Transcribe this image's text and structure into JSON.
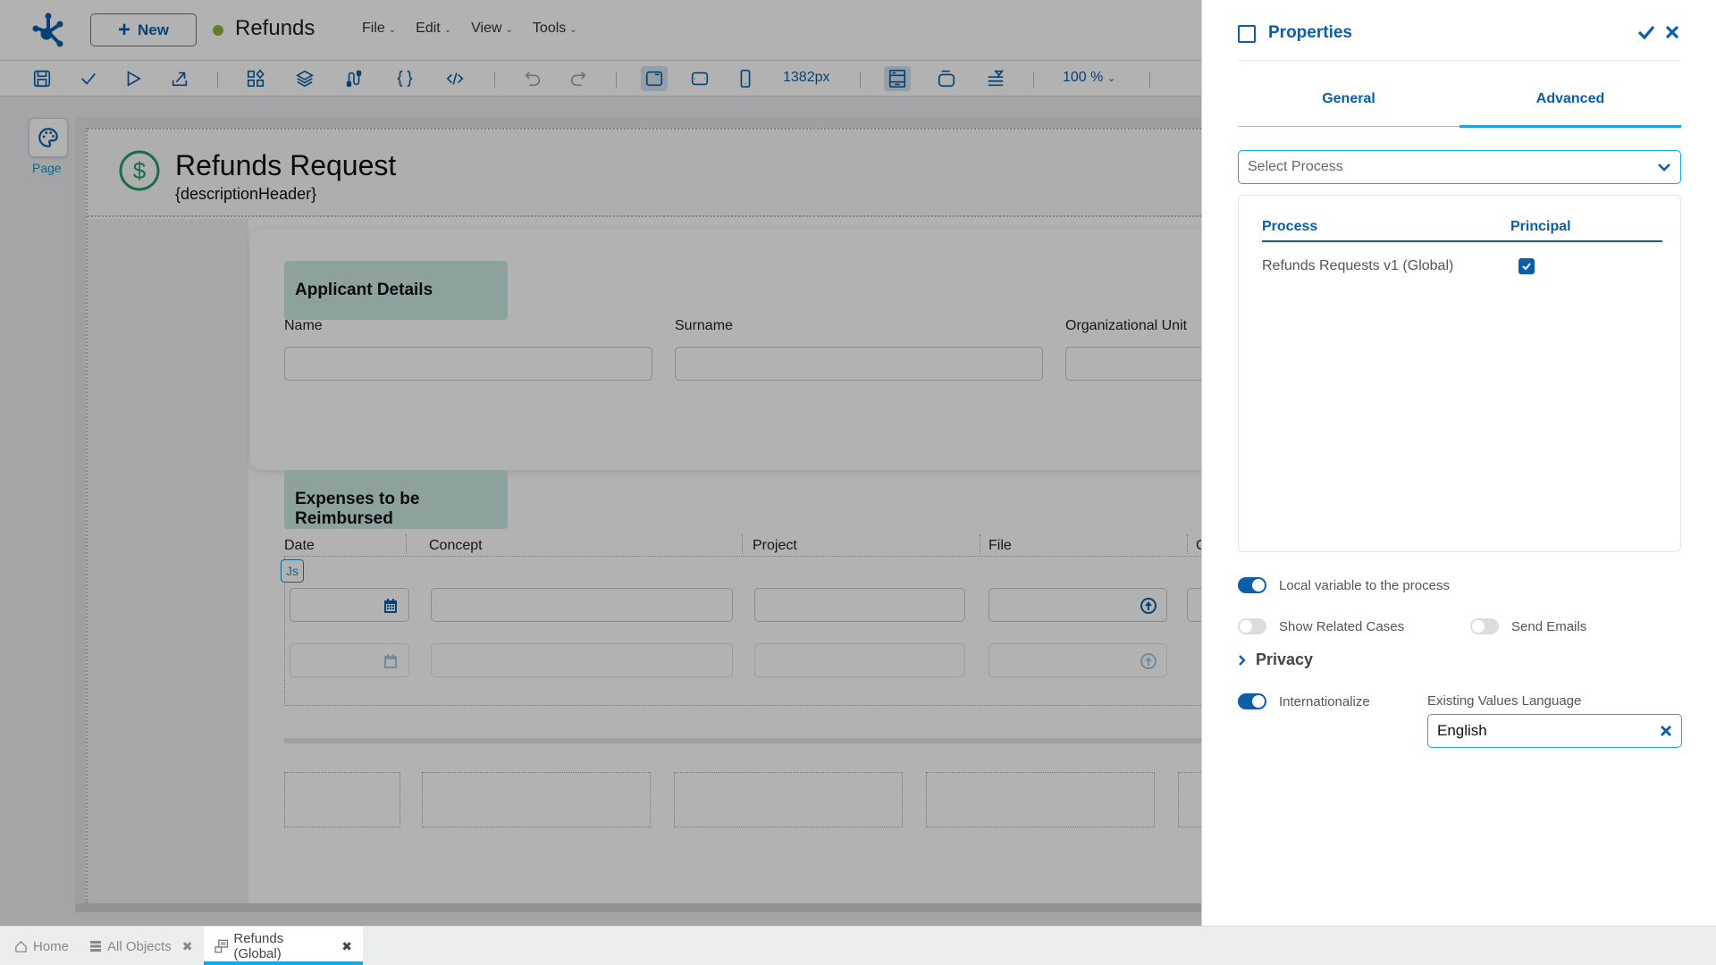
{
  "app": {
    "new_button": "New",
    "document_title": "Refunds",
    "status_color": "#8db53b",
    "menus": [
      "File",
      "Edit",
      "View",
      "Tools"
    ]
  },
  "toolbar": {
    "icons": [
      "save-icon",
      "check-icon",
      "play-icon",
      "publish-icon",
      "components-icon",
      "layers-icon",
      "variables-icon",
      "braces-icon",
      "code-icon",
      "undo-icon",
      "redo-icon",
      "desktop-view-icon",
      "tablet-view-icon",
      "mobile-view-icon",
      "layout-icon",
      "container-icon",
      "filter-icon"
    ],
    "width_readout": "1382px",
    "zoom_level": "100 %"
  },
  "sidebar": {
    "page_tool_label": "Page"
  },
  "form": {
    "title": "Refunds Request",
    "description": "{descriptionHeader}",
    "sections": [
      {
        "title": "Applicant Details",
        "fields": [
          "Name",
          "Surname",
          "Organizational Unit"
        ]
      },
      {
        "title": "Expenses to be Reimbursed",
        "columns": [
          "Date",
          "Concept",
          "Project",
          "File",
          "C"
        ],
        "js_badge": "Js"
      }
    ]
  },
  "properties": {
    "title": "Properties",
    "tabs": [
      {
        "label": "General",
        "active": false
      },
      {
        "label": "Advanced",
        "active": true
      }
    ],
    "select_process_placeholder": "Select Process",
    "process_table": {
      "headers": [
        "Process",
        "Principal"
      ],
      "rows": [
        {
          "process": "Refunds Requests v1 (Global)",
          "principal": true
        }
      ]
    },
    "toggles": {
      "local_variable": {
        "label": "Local variable to the process",
        "on": true
      },
      "show_related_cases": {
        "label": "Show Related Cases",
        "on": false
      },
      "send_emails": {
        "label": "Send Emails",
        "on": false
      },
      "internationalize": {
        "label": "Internationalize",
        "on": true
      }
    },
    "privacy_label": "Privacy",
    "existing_values_language_label": "Existing Values Language",
    "existing_values_language_value": "English"
  },
  "bottom_tabs": [
    {
      "label": "Home",
      "closable": false,
      "active": false
    },
    {
      "label": "All Objects",
      "closable": true,
      "active": false
    },
    {
      "label": "Refunds (Global)",
      "closable": true,
      "active": true
    }
  ],
  "colors": {
    "primary": "#0b5ea8",
    "accent": "#1aa6e4",
    "section_tag": "#cbe8e0",
    "dollar_icon": "#2a9d6f"
  }
}
